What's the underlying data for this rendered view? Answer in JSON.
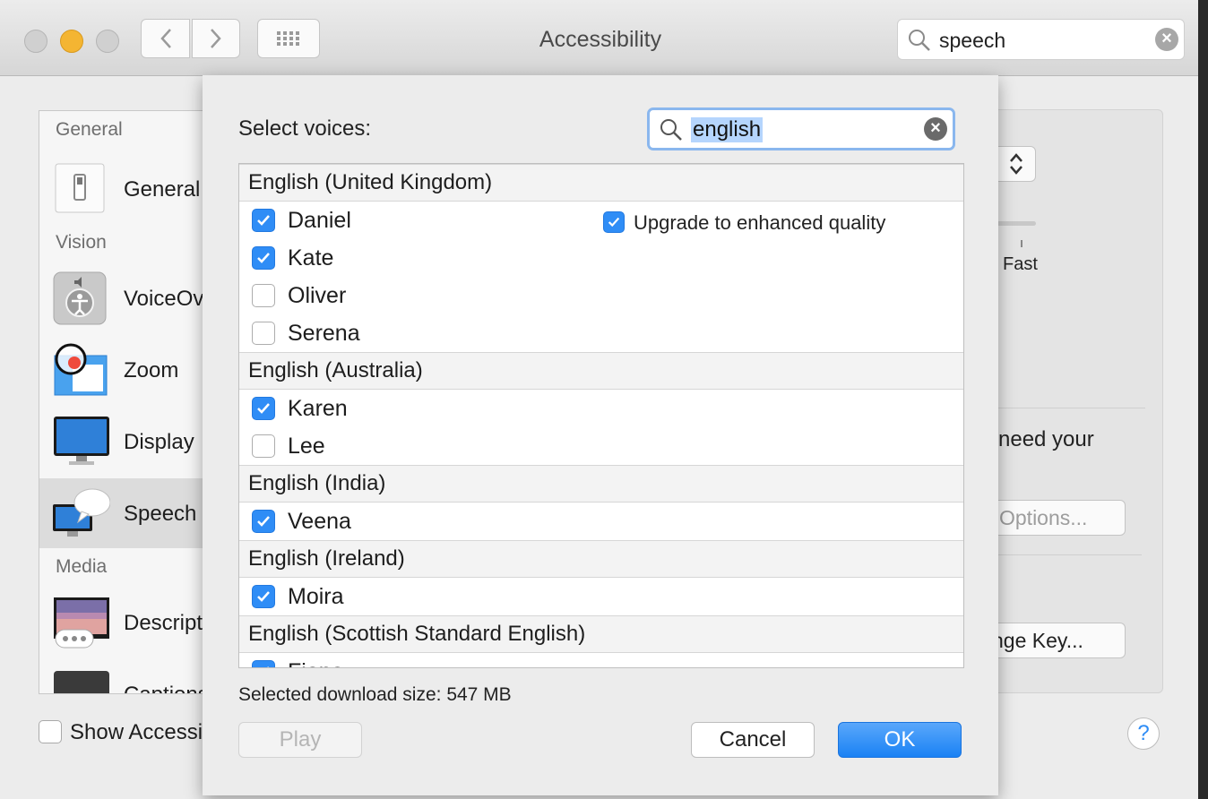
{
  "window": {
    "title": "Accessibility",
    "search_value": "speech"
  },
  "sidebar": {
    "headers": [
      "General",
      "Vision",
      "Media"
    ],
    "items": [
      {
        "label": "General",
        "icon": "switch-icon"
      },
      {
        "label": "VoiceOver",
        "icon": "voiceover-icon"
      },
      {
        "label": "Zoom",
        "icon": "zoom-icon"
      },
      {
        "label": "Display",
        "icon": "display-icon"
      },
      {
        "label": "Speech",
        "icon": "speech-icon",
        "selected": true
      },
      {
        "label": "Descriptions",
        "icon": "descriptions-icon"
      },
      {
        "label": "Captions",
        "icon": "captions-icon"
      }
    ],
    "show_accessibility_label": "Show Accessibility status in menu bar"
  },
  "right_panel": {
    "fast_label": "Fast",
    "need_text": "need your",
    "options_button": "Options...",
    "change_key_button": "nge Key..."
  },
  "sheet": {
    "select_label": "Select voices:",
    "search_value": "english",
    "groups": [
      {
        "name": "English (United Kingdom)",
        "voices": [
          {
            "name": "Daniel",
            "checked": true
          },
          {
            "name": "Kate",
            "checked": true
          },
          {
            "name": "Oliver",
            "checked": false
          },
          {
            "name": "Serena",
            "checked": false
          }
        ]
      },
      {
        "name": "English (Australia)",
        "voices": [
          {
            "name": "Karen",
            "checked": true
          },
          {
            "name": "Lee",
            "checked": false
          }
        ]
      },
      {
        "name": "English (India)",
        "voices": [
          {
            "name": "Veena",
            "checked": true
          }
        ]
      },
      {
        "name": "English (Ireland)",
        "voices": [
          {
            "name": "Moira",
            "checked": true
          }
        ]
      },
      {
        "name": "English (Scottish Standard English)",
        "voices": [
          {
            "name": "Fiona",
            "checked": true
          }
        ]
      }
    ],
    "upgrade_label": "Upgrade to enhanced quality",
    "upgrade_checked": true,
    "download_size": "Selected download size: 547 MB",
    "play_label": "Play",
    "cancel_label": "Cancel",
    "ok_label": "OK"
  },
  "colors": {
    "accent": "#2f8df6",
    "selection_highlight": "#b5d5fd"
  }
}
